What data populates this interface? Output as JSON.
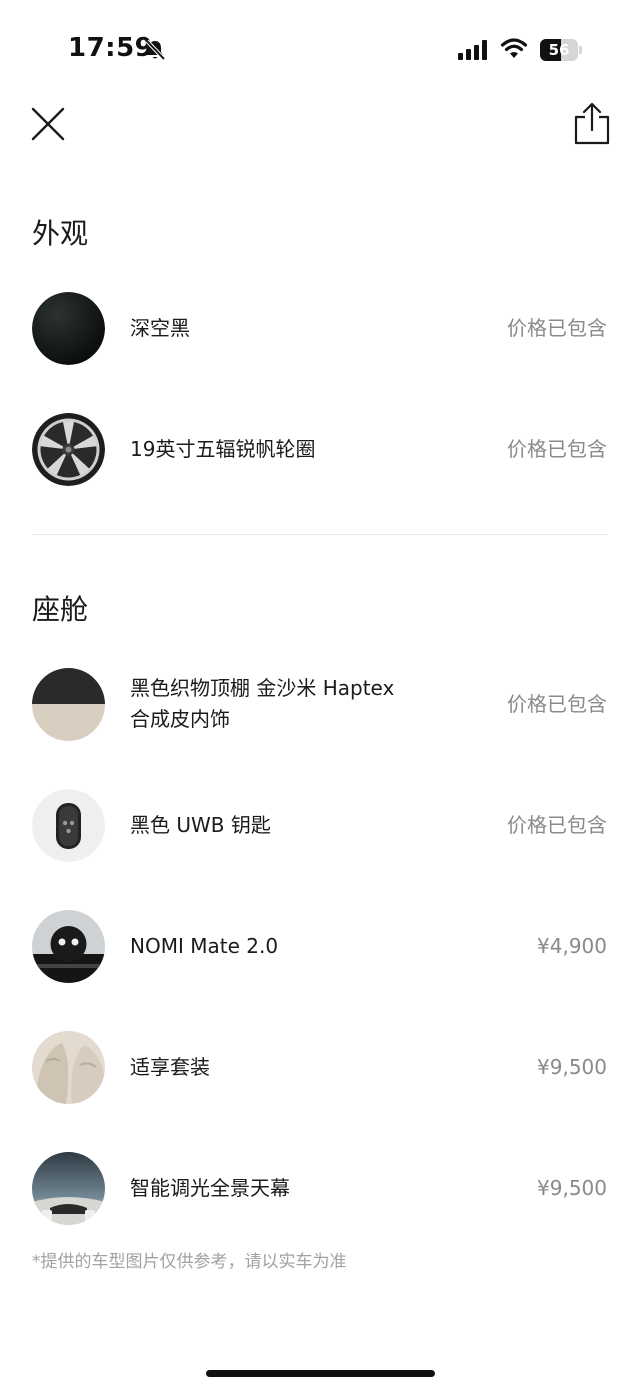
{
  "status_bar": {
    "time": "17:59",
    "battery_level": "56",
    "battery_fraction": 0.56,
    "signal_bars": 4
  },
  "sections": {
    "exterior_title": "外观",
    "cabin_title": "座舱"
  },
  "exterior_items": [
    {
      "name": "深空黑",
      "price": "价格已包含",
      "thumb": "black-paint-swatch"
    },
    {
      "name": "19英寸五辐锐帆轮圈",
      "price": "价格已包含",
      "thumb": "wheel-rim"
    }
  ],
  "cabin_items": [
    {
      "name_line1": "黑色织物顶棚 金沙米 Haptex",
      "name_line2": "合成皮内饰",
      "price": "价格已包含",
      "thumb": "interior-swatch"
    },
    {
      "name": "黑色 UWB 钥匙",
      "price": "价格已包含",
      "thumb": "key-fob"
    },
    {
      "name": "NOMI Mate 2.0",
      "price": "¥4,900",
      "thumb": "nomi-robot"
    },
    {
      "name": "适享套装",
      "price": "¥9,500",
      "thumb": "seat-comfort"
    },
    {
      "name": "智能调光全景天幕",
      "price": "¥9,500",
      "thumb": "panoramic-roof"
    }
  ],
  "disclaimer": "*提供的车型图片仅供参考，请以实车为准",
  "colors": {
    "text_primary": "#1b1b1b",
    "text_secondary": "#8a8a8a",
    "divider": "#e6e6e6",
    "background": "#ffffff"
  }
}
